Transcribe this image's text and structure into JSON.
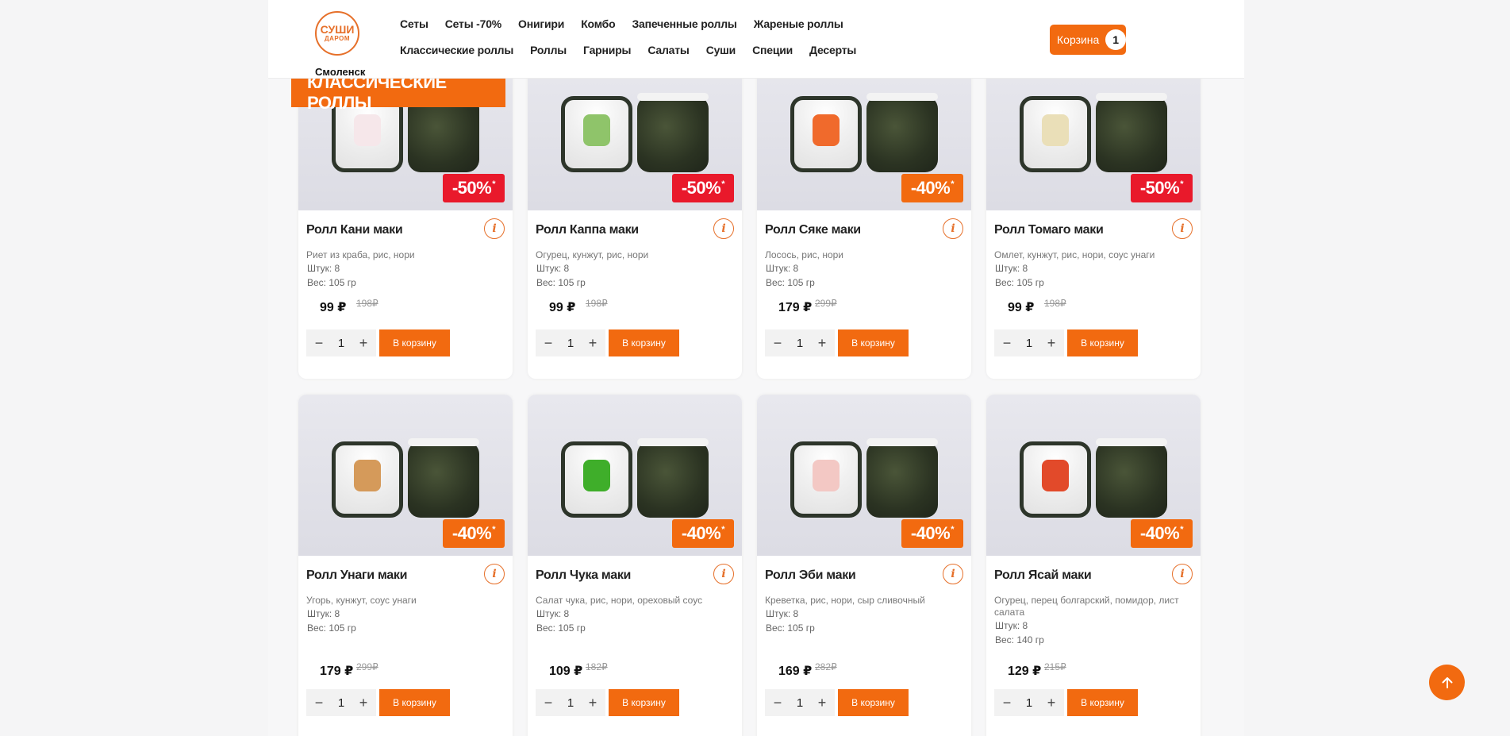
{
  "header": {
    "logo_line1": "СУШИ",
    "logo_line2": "ДАРОМ",
    "city": "Смоленск",
    "nav": [
      "Сеты",
      "Сеты -70%",
      "Онигири",
      "Комбо",
      "Запеченные роллы",
      "Жареные роллы",
      "Классические роллы",
      "Роллы",
      "Гарниры",
      "Салаты",
      "Суши",
      "Специи",
      "Десерты"
    ],
    "cart_label": "Корзина",
    "cart_count": "1"
  },
  "section_title": "КЛАССИЧЕСКИЕ РОЛЛЫ",
  "labels": {
    "add_to_cart": "В корзину",
    "minus": "−",
    "plus": "+",
    "info": "i"
  },
  "products": [
    {
      "name": "Ролл Кани маки",
      "desc": "Риет из краба, рис, нори",
      "pieces": "Штук: 8",
      "weight": "Вес: 105 гр",
      "price": "99 ₽",
      "old_price": "198₽",
      "discount": "-50%",
      "discount_color": "#e9192b",
      "filling_color": "#f6e7ea",
      "qty": "1"
    },
    {
      "name": "Ролл Каппа маки",
      "desc": "Огурец, кунжут, рис, нори",
      "pieces": "Штук: 8",
      "weight": "Вес: 105 гр",
      "price": "99 ₽",
      "old_price": "198₽",
      "discount": "-50%",
      "discount_color": "#e9192b",
      "filling_color": "#8fc46a",
      "qty": "1"
    },
    {
      "name": "Ролл Сяке маки",
      "desc": "Лосось, рис, нори",
      "pieces": "Штук: 8",
      "weight": "Вес: 105 гр",
      "price": "179 ₽",
      "old_price": "299₽",
      "discount": "-40%",
      "discount_color": "#f26a10",
      "filling_color": "#f06a2c",
      "qty": "1"
    },
    {
      "name": "Ролл Томаго маки",
      "desc": "Омлет, кунжут, рис, нори, соус унаги",
      "pieces": "Штук: 8",
      "weight": "Вес: 105 гр",
      "price": "99 ₽",
      "old_price": "198₽",
      "discount": "-50%",
      "discount_color": "#e9192b",
      "filling_color": "#eadfb8",
      "qty": "1"
    },
    {
      "name": "Ролл Унаги маки",
      "desc": "Угорь, кунжут, соус унаги",
      "pieces": "Штук: 8",
      "weight": "Вес: 105 гр",
      "price": "179 ₽",
      "old_price": "299₽",
      "discount": "-40%",
      "discount_color": "#f26a10",
      "filling_color": "#d59a5a",
      "qty": "1"
    },
    {
      "name": "Ролл Чука маки",
      "desc": "Салат чука, рис, нори, ореховый соус",
      "pieces": "Штук: 8",
      "weight": "Вес: 105 гр",
      "price": "109 ₽",
      "old_price": "182₽",
      "discount": "-40%",
      "discount_color": "#f26a10",
      "filling_color": "#3fae2a",
      "qty": "1"
    },
    {
      "name": "Ролл Эби маки",
      "desc": "Креветка, рис, нори, сыр сливочный",
      "pieces": "Штук: 8",
      "weight": "Вес: 105 гр",
      "price": "169 ₽",
      "old_price": "282₽",
      "discount": "-40%",
      "discount_color": "#f26a10",
      "filling_color": "#f3c8c4",
      "qty": "1"
    },
    {
      "name": "Ролл Ясай маки",
      "desc": "Огурец, перец болгарский, помидор, лист салата",
      "pieces": "Штук: 8",
      "weight": "Вес: 140 гр",
      "price": "129 ₽",
      "old_price": "215₽",
      "discount": "-40%",
      "discount_color": "#f26a10",
      "filling_color": "#e24a2a",
      "qty": "1"
    }
  ],
  "colors": {
    "accent": "#f26a10",
    "sale_red": "#e9192b"
  },
  "icons": {
    "info": "info-icon",
    "scroll_top": "arrow-up-icon"
  }
}
